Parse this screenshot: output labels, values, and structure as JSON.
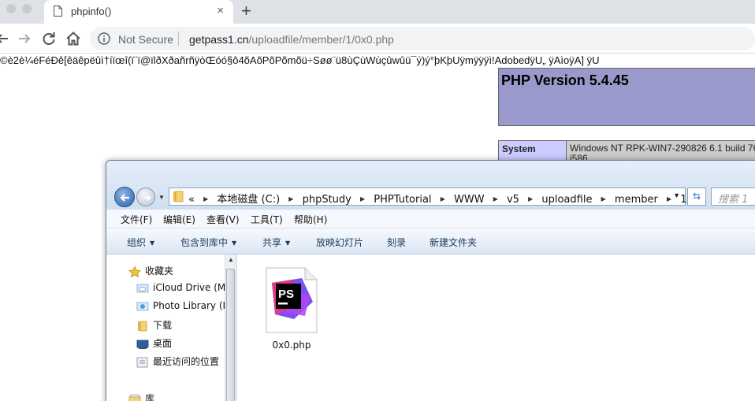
{
  "browser": {
    "tab_title": "phpinfo()",
    "tab_close": "×",
    "new_tab": "+",
    "security_label": "Not Secure",
    "url_host": "getpass1.cn",
    "url_path": "/uploadfile/member/1/0x0.php"
  },
  "page": {
    "garbage_text": "©è2è¼éFéÐê[êäêpëûì†íïœî(ï¨ï@ïlðXðañrñÿòŒóó§ô4õAõPõPõmõü÷Søø¨ü8ùÇùWùçûwûü¯ý)ý°þKþUÿmÿÿÿì!AdobedÿU„      ÿAìoÿA]   ÿU",
    "php_version": "PHP Version 5.4.45",
    "system_key": "System",
    "system_value": "Windows NT RPK-WIN7-290826 6.1 build 76 i586"
  },
  "explorer": {
    "breadcrumb": {
      "overflow": "«",
      "items": [
        "本地磁盘 (C:)",
        "phpStudy",
        "PHPTutorial",
        "WWW",
        "v5",
        "uploadfile",
        "member",
        "1"
      ]
    },
    "search_placeholder": "搜索 1",
    "menu": [
      "文件(F)",
      "编辑(E)",
      "查看(V)",
      "工具(T)",
      "帮助(H)"
    ],
    "commands": [
      "组织",
      "包含到库中",
      "共享",
      "放映幻灯片",
      "刻录",
      "新建文件夹"
    ],
    "nav": {
      "favorites": "收藏夹",
      "items": [
        "iCloud Drive (M",
        "Photo Library (I",
        "下载",
        "桌面",
        "最近访问的位置"
      ],
      "library": "库"
    },
    "file": {
      "name": "0x0.php",
      "icon_text": "PS"
    }
  },
  "colors": {
    "php_header": "#9999cc",
    "php_key": "#ccccff",
    "php_value": "#cccccc",
    "phpstorm_pink": "#e3378a",
    "phpstorm_purple": "#7b4ff0"
  }
}
